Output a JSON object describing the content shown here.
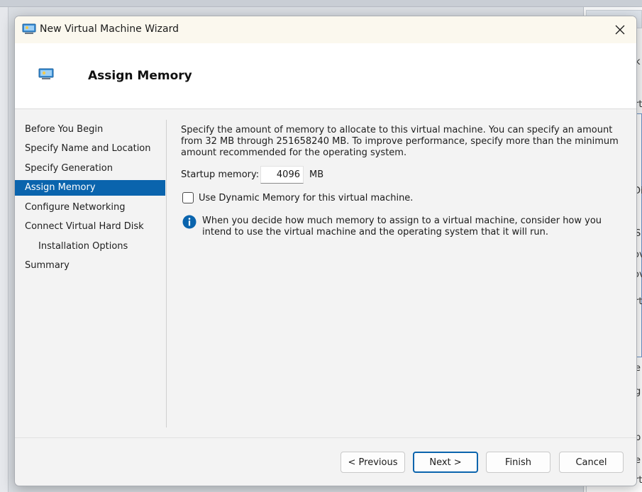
{
  "window": {
    "title": "New Virtual Machine Wizard",
    "close_glyph": "✕"
  },
  "header": {
    "title": "Assign Memory"
  },
  "nav": {
    "items": [
      {
        "label": "Before You Begin"
      },
      {
        "label": "Specify Name and Location"
      },
      {
        "label": "Specify Generation"
      },
      {
        "label": "Assign Memory"
      },
      {
        "label": "Configure Networking"
      },
      {
        "label": "Connect Virtual Hard Disk"
      },
      {
        "label": "Installation Options"
      },
      {
        "label": "Summary"
      }
    ],
    "active_index": 3
  },
  "content": {
    "description": "Specify the amount of memory to allocate to this virtual machine. You can specify an amount from 32 MB through 251658240 MB. To improve performance, specify more than the minimum amount recommended for the operating system.",
    "startup_memory_label": "Startup memory:",
    "startup_memory_value": "4096",
    "startup_memory_unit": "MB",
    "dynamic_memory_label": "Use Dynamic Memory for this virtual machine.",
    "dynamic_memory_checked": false,
    "info_text": "When you decide how much memory to assign to a virtual machine, consider how you intend to use the virtual machine and the operating system that it will run."
  },
  "buttons": {
    "previous": "< Previous",
    "next": "Next >",
    "finish": "Finish",
    "cancel": "Cancel"
  },
  "background": {
    "right_letters": [
      "k",
      "rt",
      "Di",
      "ov",
      "S",
      "ov",
      "rt",
      "e",
      "g",
      "p",
      "e",
      "rt"
    ]
  },
  "colors": {
    "accent": "#0a64ad",
    "title_bar": "#fbf8ee",
    "dialog_bg": "#f3f3f3",
    "info_icon": "#0a64ad"
  }
}
